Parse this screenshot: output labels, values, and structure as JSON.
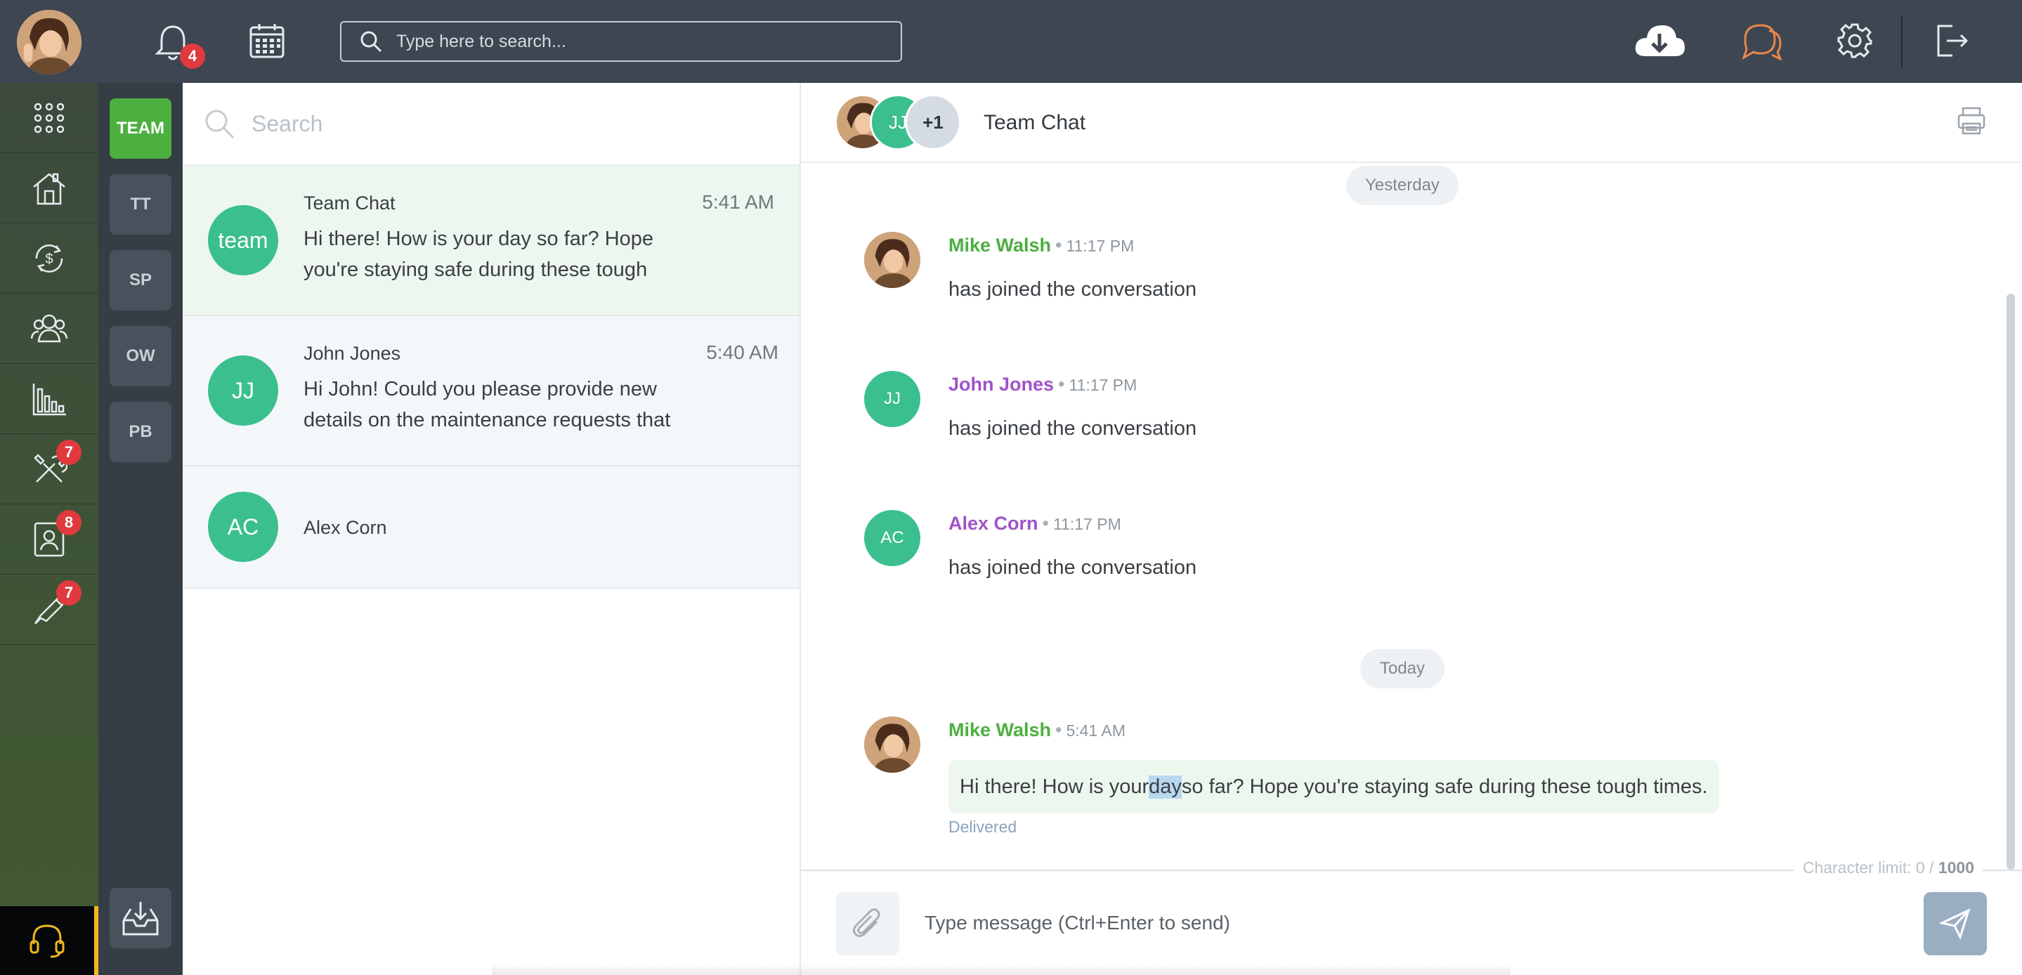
{
  "topbar": {
    "notification_count": "4",
    "search_placeholder": "Type here to search...",
    "icons": [
      "bell-icon",
      "calendar-icon",
      "search-icon",
      "cloud-download-icon",
      "chat-icon",
      "gear-icon",
      "logout-icon"
    ],
    "chat_icon_color": "#e8874a"
  },
  "leftnav": {
    "items": [
      {
        "name": "apps-grid-icon",
        "badge": ""
      },
      {
        "name": "property-icon",
        "badge": ""
      },
      {
        "name": "payments-icon",
        "badge": ""
      },
      {
        "name": "contacts-icon",
        "badge": ""
      },
      {
        "name": "reports-icon",
        "badge": ""
      },
      {
        "name": "maintenance-icon",
        "badge": "7"
      },
      {
        "name": "tenant-icon",
        "badge": "8"
      },
      {
        "name": "tools-icon",
        "badge": "7"
      }
    ],
    "help_icon": "headset-icon",
    "help_accent": "#f1b81d"
  },
  "subnav": {
    "groups": [
      "TEAM",
      "TT",
      "SP",
      "OW",
      "PB"
    ],
    "active": "TEAM",
    "active_color": "#4caf3f",
    "archive_icon": "inbox-download-icon"
  },
  "conversations": {
    "search_placeholder": "Search",
    "items": [
      {
        "avatar": "team",
        "name": "Team Chat",
        "time": "5:41 AM",
        "preview": "Hi there! How is your day so far? Hope you're staying safe during these tough"
      },
      {
        "avatar": "JJ",
        "name": "John Jones",
        "time": "5:40 AM",
        "preview": "Hi John! Could you please provide new details on the maintenance requests that"
      },
      {
        "avatar": "AC",
        "name": "Alex Corn",
        "time": "",
        "preview": ""
      }
    ]
  },
  "chat": {
    "header_avatars": [
      "JJ",
      "+1"
    ],
    "title": "Team Chat",
    "day_yesterday": "Yesterday",
    "day_today": "Today",
    "messages": [
      {
        "author": "Mike Walsh",
        "time": "11:17 PM",
        "text": "has joined the conversation",
        "author_color": "#4caf3f"
      },
      {
        "author": "John Jones",
        "avatar": "JJ",
        "time": "11:17 PM",
        "text": "has joined the conversation",
        "author_color": "#a052c9"
      },
      {
        "author": "Alex Corn",
        "avatar": "AC",
        "time": "11:17 PM",
        "text": "has joined the conversation",
        "author_color": "#a052c9"
      },
      {
        "author": "Mike Walsh",
        "time": "5:41 AM",
        "text_before": "Hi there! How is your ",
        "text_highlight": "day",
        "text_after": " so far? Hope you're staying safe during these tough times.",
        "status": "Delivered",
        "author_color": "#4caf3f"
      }
    ],
    "char_limit_label": "Character limit: 0 / ",
    "char_limit_max": "1000",
    "composer_placeholder": "Type message (Ctrl+Enter to send)"
  },
  "annotation": {
    "arrow_color": "#e0151b"
  }
}
